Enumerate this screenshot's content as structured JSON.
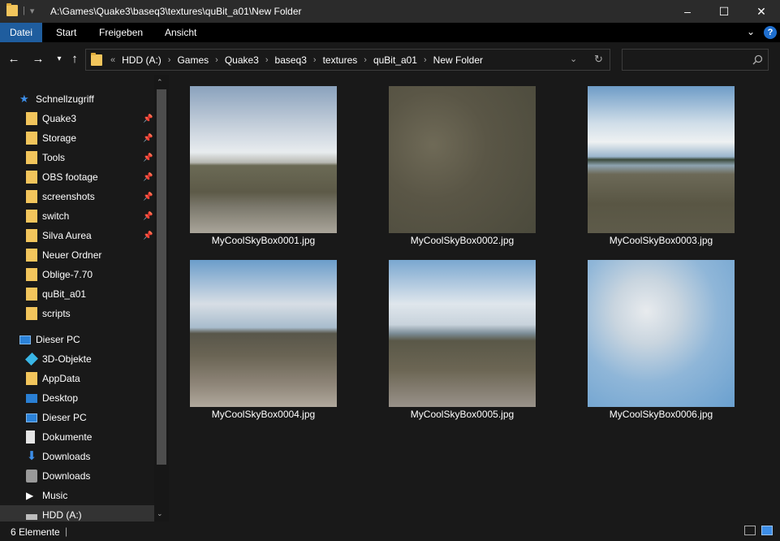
{
  "window": {
    "title": "A:\\Games\\Quake3\\baseq3\\textures\\quBit_a01\\New Folder",
    "minimize_glyph": "–",
    "maximize_glyph": "☐",
    "close_glyph": "✕"
  },
  "ribbon": {
    "tabs": [
      {
        "label": "Datei"
      },
      {
        "label": "Start"
      },
      {
        "label": "Freigeben"
      },
      {
        "label": "Ansicht"
      }
    ],
    "help_glyph": "?"
  },
  "address": {
    "overflow": "«",
    "path": [
      "HDD (A:)",
      "Games",
      "Quake3",
      "baseq3",
      "textures",
      "quBit_a01",
      "New Folder"
    ]
  },
  "sidebar": {
    "quick_access": {
      "label": "Schnellzugriff"
    },
    "quick_items": [
      {
        "label": "Quake3",
        "pinned": true
      },
      {
        "label": "Storage",
        "pinned": true
      },
      {
        "label": "Tools",
        "pinned": true
      },
      {
        "label": "OBS footage",
        "pinned": true
      },
      {
        "label": "screenshots",
        "pinned": true
      },
      {
        "label": "switch",
        "pinned": true
      },
      {
        "label": "Silva Aurea",
        "pinned": true
      },
      {
        "label": "Neuer Ordner",
        "pinned": false
      },
      {
        "label": "Oblige-7.70",
        "pinned": false
      },
      {
        "label": "quBit_a01",
        "pinned": false
      },
      {
        "label": "scripts",
        "pinned": false
      }
    ],
    "this_pc": {
      "label": "Dieser PC"
    },
    "pc_items": [
      {
        "label": "3D-Objekte",
        "icon": "cube-icon"
      },
      {
        "label": "AppData",
        "icon": "folder-icon"
      },
      {
        "label": "Desktop",
        "icon": "desktop-icon"
      },
      {
        "label": "Dieser PC",
        "icon": "computer-icon"
      },
      {
        "label": "Dokumente",
        "icon": "document-icon"
      },
      {
        "label": "Downloads",
        "icon": "download-icon"
      },
      {
        "label": "Downloads",
        "icon": "drive-icon"
      },
      {
        "label": "Music",
        "icon": "music-icon"
      },
      {
        "label": "HDD (A:)",
        "icon": "hdd-icon"
      }
    ]
  },
  "files": [
    {
      "name": "MyCoolSkyBox0001.jpg"
    },
    {
      "name": "MyCoolSkyBox0002.jpg"
    },
    {
      "name": "MyCoolSkyBox0003.jpg"
    },
    {
      "name": "MyCoolSkyBox0004.jpg"
    },
    {
      "name": "MyCoolSkyBox0005.jpg"
    },
    {
      "name": "MyCoolSkyBox0006.jpg"
    }
  ],
  "status": {
    "count": "6 Elemente"
  },
  "colors": {
    "accent": "#1f5d9e",
    "folder": "#f2c55c",
    "background": "#191919"
  }
}
